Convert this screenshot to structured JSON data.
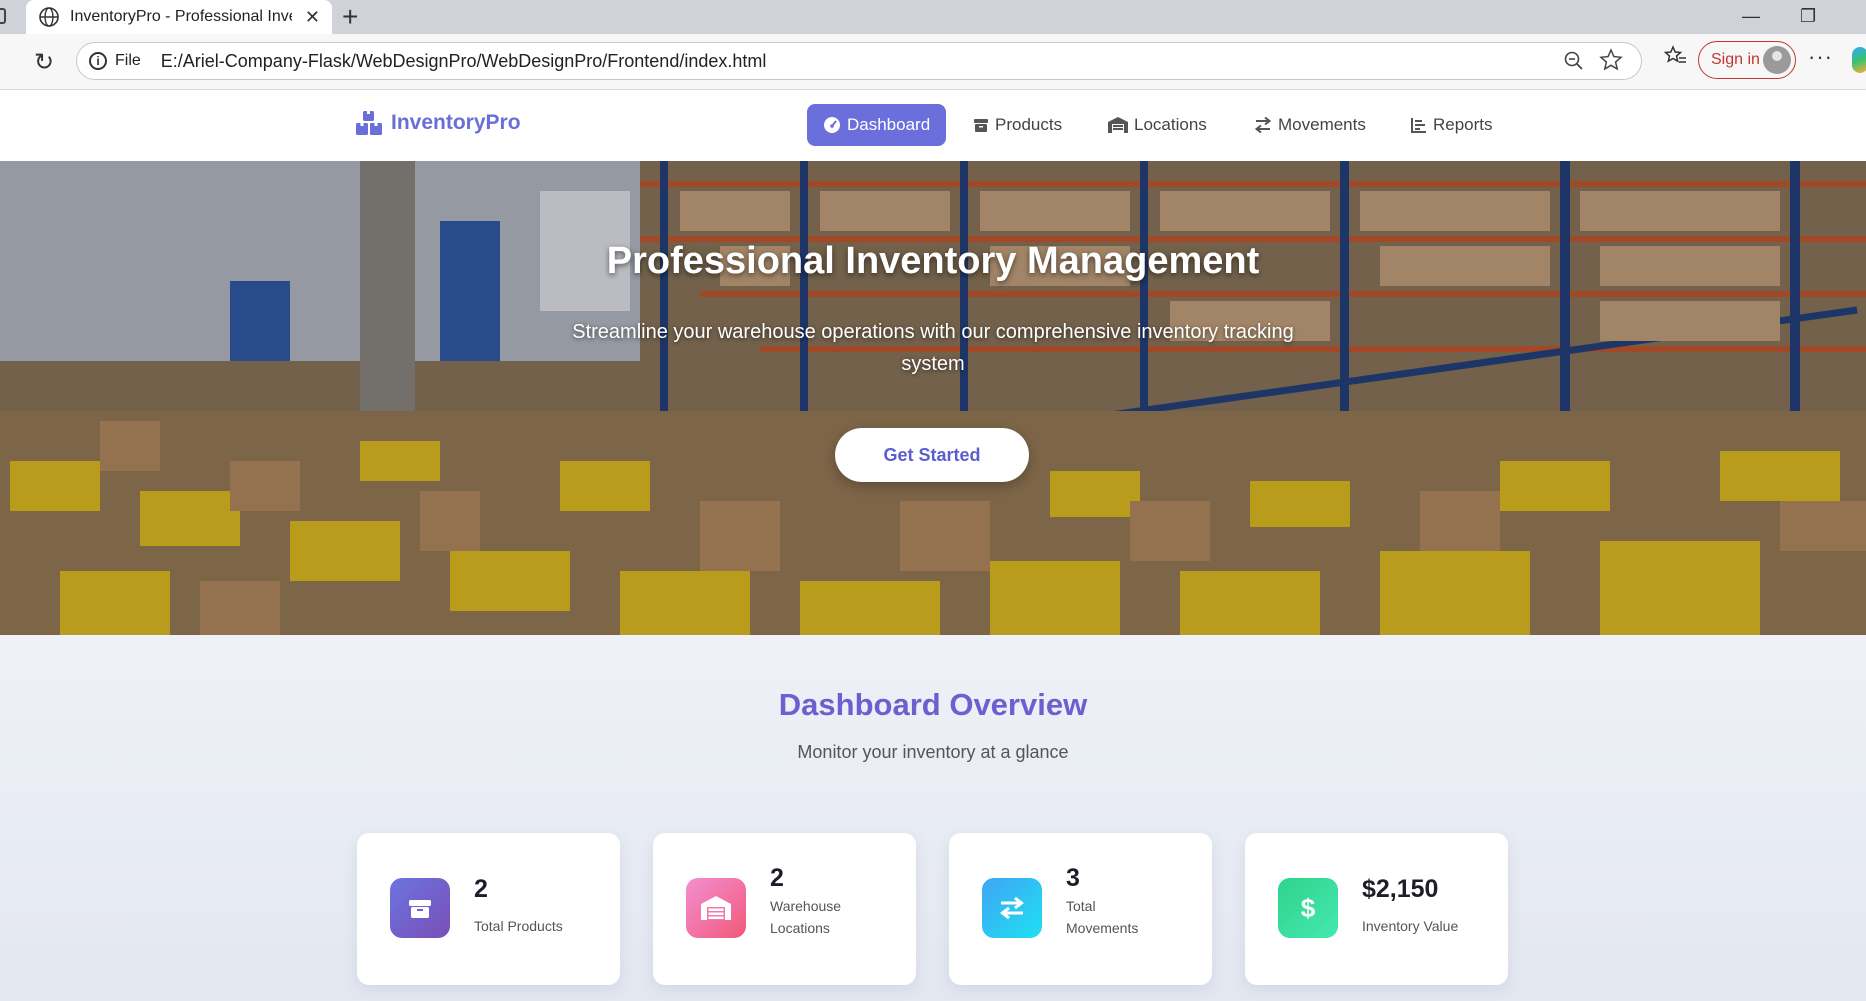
{
  "browser": {
    "tab_title": "InventoryPro - Professional Invent",
    "tab_close": "✕",
    "new_tab": "+",
    "address_scheme": "File",
    "address_url": "E:/Ariel-Company-Flask/WebDesignPro/WebDesignPro/Frontend/index.html",
    "signin_label": "Sign in",
    "minimize": "—",
    "restore": "❐",
    "more": "···"
  },
  "navbar": {
    "brand": "InventoryPro",
    "items": [
      {
        "label": "Dashboard",
        "icon": "gauge-icon",
        "active": true
      },
      {
        "label": "Products",
        "icon": "box-icon",
        "active": false
      },
      {
        "label": "Locations",
        "icon": "warehouse-icon",
        "active": false
      },
      {
        "label": "Movements",
        "icon": "exchange-icon",
        "active": false
      },
      {
        "label": "Reports",
        "icon": "chart-icon",
        "active": false
      }
    ],
    "accent_color": "#6b6fdc"
  },
  "hero": {
    "title": "Professional Inventory Management",
    "subtitle": "Streamline your warehouse operations with our comprehensive inventory tracking system",
    "cta_label": "Get Started"
  },
  "dashboard": {
    "title": "Dashboard Overview",
    "subtitle": "Monitor your inventory at a glance",
    "stats": [
      {
        "value": "2",
        "label": "Total Products",
        "icon": "box-icon",
        "color": "#6b5fcf"
      },
      {
        "value": "2",
        "label": "Warehouse Locations",
        "icon": "warehouse-icon",
        "color": "#f26ba0"
      },
      {
        "value": "3",
        "label": "Total Movements",
        "icon": "exchange-icon",
        "color": "#27b8f2"
      },
      {
        "value": "$2,150",
        "label": "Inventory Value",
        "icon": "dollar-icon",
        "color": "#35d690"
      }
    ]
  }
}
